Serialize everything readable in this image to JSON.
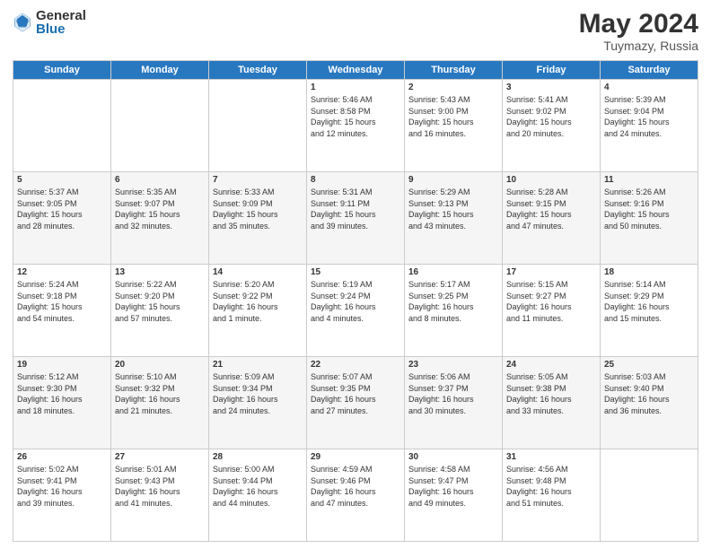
{
  "logo": {
    "general": "General",
    "blue": "Blue"
  },
  "title": "May 2024",
  "location": "Tuymazy, Russia",
  "days_of_week": [
    "Sunday",
    "Monday",
    "Tuesday",
    "Wednesday",
    "Thursday",
    "Friday",
    "Saturday"
  ],
  "weeks": [
    [
      {
        "num": "",
        "info": ""
      },
      {
        "num": "",
        "info": ""
      },
      {
        "num": "",
        "info": ""
      },
      {
        "num": "1",
        "info": "Sunrise: 5:46 AM\nSunset: 8:58 PM\nDaylight: 15 hours\nand 12 minutes."
      },
      {
        "num": "2",
        "info": "Sunrise: 5:43 AM\nSunset: 9:00 PM\nDaylight: 15 hours\nand 16 minutes."
      },
      {
        "num": "3",
        "info": "Sunrise: 5:41 AM\nSunset: 9:02 PM\nDaylight: 15 hours\nand 20 minutes."
      },
      {
        "num": "4",
        "info": "Sunrise: 5:39 AM\nSunset: 9:04 PM\nDaylight: 15 hours\nand 24 minutes."
      }
    ],
    [
      {
        "num": "5",
        "info": "Sunrise: 5:37 AM\nSunset: 9:05 PM\nDaylight: 15 hours\nand 28 minutes."
      },
      {
        "num": "6",
        "info": "Sunrise: 5:35 AM\nSunset: 9:07 PM\nDaylight: 15 hours\nand 32 minutes."
      },
      {
        "num": "7",
        "info": "Sunrise: 5:33 AM\nSunset: 9:09 PM\nDaylight: 15 hours\nand 35 minutes."
      },
      {
        "num": "8",
        "info": "Sunrise: 5:31 AM\nSunset: 9:11 PM\nDaylight: 15 hours\nand 39 minutes."
      },
      {
        "num": "9",
        "info": "Sunrise: 5:29 AM\nSunset: 9:13 PM\nDaylight: 15 hours\nand 43 minutes."
      },
      {
        "num": "10",
        "info": "Sunrise: 5:28 AM\nSunset: 9:15 PM\nDaylight: 15 hours\nand 47 minutes."
      },
      {
        "num": "11",
        "info": "Sunrise: 5:26 AM\nSunset: 9:16 PM\nDaylight: 15 hours\nand 50 minutes."
      }
    ],
    [
      {
        "num": "12",
        "info": "Sunrise: 5:24 AM\nSunset: 9:18 PM\nDaylight: 15 hours\nand 54 minutes."
      },
      {
        "num": "13",
        "info": "Sunrise: 5:22 AM\nSunset: 9:20 PM\nDaylight: 15 hours\nand 57 minutes."
      },
      {
        "num": "14",
        "info": "Sunrise: 5:20 AM\nSunset: 9:22 PM\nDaylight: 16 hours\nand 1 minute."
      },
      {
        "num": "15",
        "info": "Sunrise: 5:19 AM\nSunset: 9:24 PM\nDaylight: 16 hours\nand 4 minutes."
      },
      {
        "num": "16",
        "info": "Sunrise: 5:17 AM\nSunset: 9:25 PM\nDaylight: 16 hours\nand 8 minutes."
      },
      {
        "num": "17",
        "info": "Sunrise: 5:15 AM\nSunset: 9:27 PM\nDaylight: 16 hours\nand 11 minutes."
      },
      {
        "num": "18",
        "info": "Sunrise: 5:14 AM\nSunset: 9:29 PM\nDaylight: 16 hours\nand 15 minutes."
      }
    ],
    [
      {
        "num": "19",
        "info": "Sunrise: 5:12 AM\nSunset: 9:30 PM\nDaylight: 16 hours\nand 18 minutes."
      },
      {
        "num": "20",
        "info": "Sunrise: 5:10 AM\nSunset: 9:32 PM\nDaylight: 16 hours\nand 21 minutes."
      },
      {
        "num": "21",
        "info": "Sunrise: 5:09 AM\nSunset: 9:34 PM\nDaylight: 16 hours\nand 24 minutes."
      },
      {
        "num": "22",
        "info": "Sunrise: 5:07 AM\nSunset: 9:35 PM\nDaylight: 16 hours\nand 27 minutes."
      },
      {
        "num": "23",
        "info": "Sunrise: 5:06 AM\nSunset: 9:37 PM\nDaylight: 16 hours\nand 30 minutes."
      },
      {
        "num": "24",
        "info": "Sunrise: 5:05 AM\nSunset: 9:38 PM\nDaylight: 16 hours\nand 33 minutes."
      },
      {
        "num": "25",
        "info": "Sunrise: 5:03 AM\nSunset: 9:40 PM\nDaylight: 16 hours\nand 36 minutes."
      }
    ],
    [
      {
        "num": "26",
        "info": "Sunrise: 5:02 AM\nSunset: 9:41 PM\nDaylight: 16 hours\nand 39 minutes."
      },
      {
        "num": "27",
        "info": "Sunrise: 5:01 AM\nSunset: 9:43 PM\nDaylight: 16 hours\nand 41 minutes."
      },
      {
        "num": "28",
        "info": "Sunrise: 5:00 AM\nSunset: 9:44 PM\nDaylight: 16 hours\nand 44 minutes."
      },
      {
        "num": "29",
        "info": "Sunrise: 4:59 AM\nSunset: 9:46 PM\nDaylight: 16 hours\nand 47 minutes."
      },
      {
        "num": "30",
        "info": "Sunrise: 4:58 AM\nSunset: 9:47 PM\nDaylight: 16 hours\nand 49 minutes."
      },
      {
        "num": "31",
        "info": "Sunrise: 4:56 AM\nSunset: 9:48 PM\nDaylight: 16 hours\nand 51 minutes."
      },
      {
        "num": "",
        "info": ""
      }
    ]
  ]
}
